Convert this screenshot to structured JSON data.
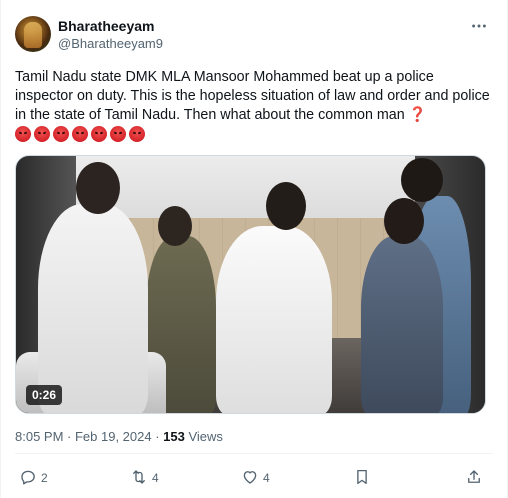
{
  "author": {
    "display_name": "Bharatheeyam",
    "handle": "@Bharatheeyam9"
  },
  "tweet": {
    "text": "Tamil Nadu state DMK MLA Mansoor Mohammed beat up a police inspector on duty. This is the hopeless situation of law and order and police in the state of Tamil Nadu. Then what about the common man",
    "trailing_symbol": "❓",
    "emoji_count": 7,
    "emoji_name": "angry-face"
  },
  "media": {
    "duration": "0:26"
  },
  "meta": {
    "timestamp": "8:05 PM · Feb 19, 2024 · ",
    "views_count": "153",
    "views_label": " Views"
  },
  "actions": {
    "replies": "2",
    "reposts": "4",
    "likes": "4"
  },
  "icons": [
    "more-icon",
    "reply-icon",
    "repost-icon",
    "like-icon",
    "bookmark-icon",
    "share-icon"
  ]
}
